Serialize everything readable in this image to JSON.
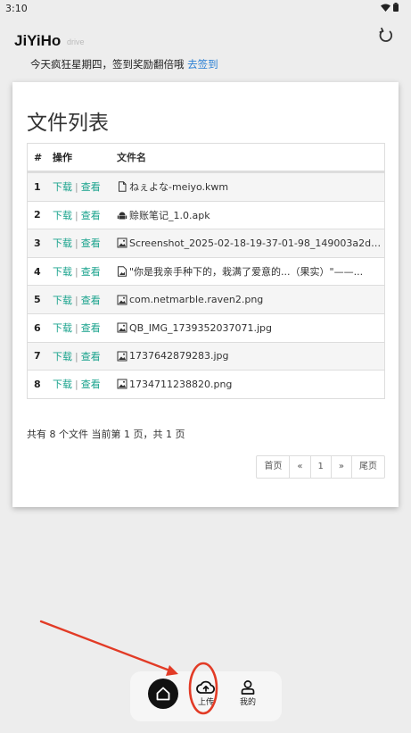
{
  "status": {
    "time": "3:10",
    "wifi_icon": "wifi-icon",
    "battery_icon": "battery-icon"
  },
  "app": {
    "brand": "JiYiHo",
    "brand_sub": "drive",
    "refresh_icon": "refresh-icon"
  },
  "notice": {
    "text": "今天疯狂星期四，签到奖励翻倍哦",
    "link": "去签到"
  },
  "filelist": {
    "title": "文件列表",
    "headers": {
      "num": "#",
      "action": "操作",
      "name": "文件名"
    },
    "download_label": "下载",
    "sep": "|",
    "view_label": "查看",
    "rows": [
      {
        "num": "1",
        "icon": "document-icon",
        "name": "ねぇよな-meiyo.kwm"
      },
      {
        "num": "2",
        "icon": "android-icon",
        "name": "赊账笔记_1.0.apk"
      },
      {
        "num": "3",
        "icon": "image-icon",
        "name": "Screenshot_2025-02-18-19-37-01-98_149003a2d40..."
      },
      {
        "num": "4",
        "icon": "image-file-icon",
        "name": "\"你是我亲手种下的，栽满了爱意的...（果实）\"——..."
      },
      {
        "num": "5",
        "icon": "image-icon",
        "name": "com.netmarble.raven2.png"
      },
      {
        "num": "6",
        "icon": "image-icon",
        "name": "QB_IMG_1739352037071.jpg"
      },
      {
        "num": "7",
        "icon": "image-icon",
        "name": "1737642879283.jpg"
      },
      {
        "num": "8",
        "icon": "image-icon",
        "name": "1734711238820.png"
      }
    ],
    "summary": "共有 8 个文件 当前第 1 页，共 1 页",
    "pager": {
      "first": "首页",
      "prev": "«",
      "page": "1",
      "next": "»",
      "last": "尾页"
    }
  },
  "bottom_nav": {
    "home_icon": "home-icon",
    "upload_label": "上传",
    "mine_label": "我的"
  },
  "colors": {
    "link": "#2a7fd4",
    "action": "#1aa38d",
    "annotation": "#e23b26"
  }
}
